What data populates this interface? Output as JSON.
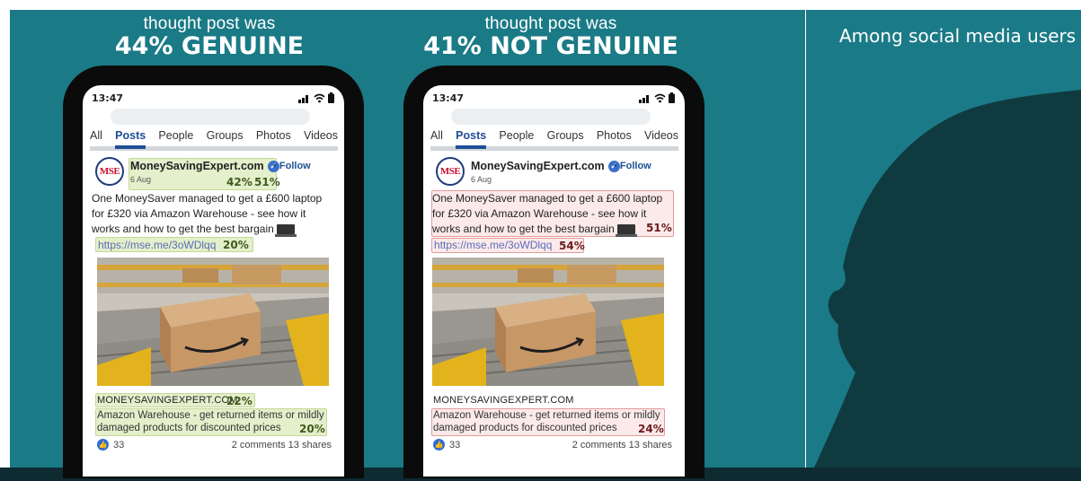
{
  "headlines": {
    "left": {
      "sub": "thought post was",
      "main": "44% GENUINE"
    },
    "right": {
      "sub": "thought post was",
      "main": "41% NOT GENUINE"
    }
  },
  "side_caption": "Among social media users",
  "post": {
    "time": "13:47",
    "tabs": [
      "All",
      "Posts",
      "People",
      "Groups",
      "Photos",
      "Videos"
    ],
    "active_tab": "Posts",
    "logo_text": "MSE",
    "account_name": "MoneySavingExpert.com",
    "follow_label": "• Follow",
    "date": "6 Aug",
    "body": "One MoneySaver managed to get a £600 laptop for £320 via Amazon Warehouse - see how it works and how to get the best bargain",
    "link": "https://mse.me/3oWDlqq",
    "domain": "MONEYSAVINGEXPERT.COM",
    "description": "Amazon Warehouse - get returned items or mildly damaged products for discounted prices",
    "likes": "33",
    "shares": "2 comments 13 shares"
  },
  "genuine_phone": {
    "account_pct_a": "42%",
    "account_pct_b": "51%",
    "link_pct": "20%",
    "domain_pct": "22%",
    "description_pct": "20%"
  },
  "not_genuine_phone": {
    "body_pct": "51%",
    "link_pct": "54%",
    "description_pct": "24%"
  },
  "colors": {
    "background": "#1a7a86",
    "genuine_highlight": "#dfeab8",
    "not_genuine_highlight": "#f7dede",
    "bottom_bar": "#0d2b30"
  }
}
